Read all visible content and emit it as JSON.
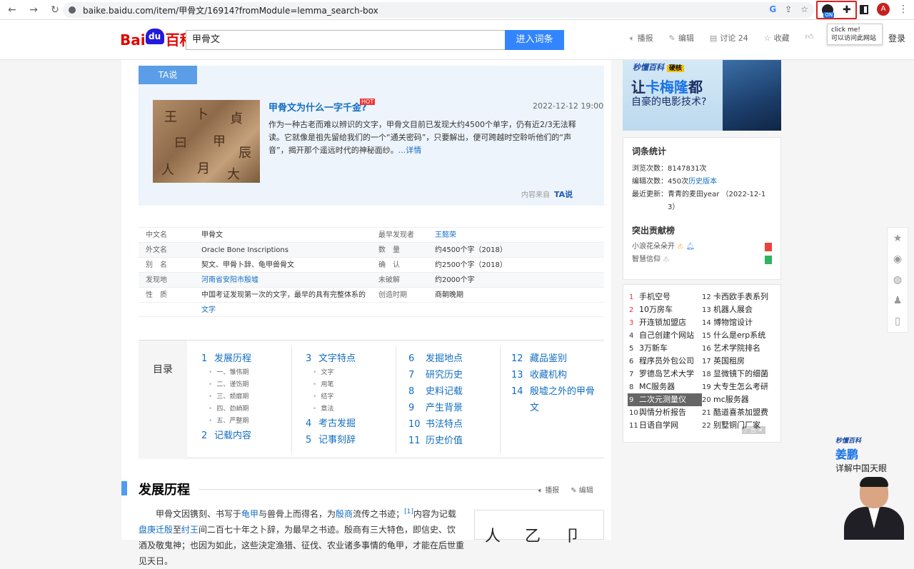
{
  "browser": {
    "url": "baike.baidu.com/item/甲骨文/16914?fromModule=lemma_search-box",
    "avatar_letter": "A",
    "ext_badge": "ON",
    "tooltip_line1": "click me!",
    "tooltip_line2": "可以访问此网站"
  },
  "header": {
    "logo_bai": "Bai",
    "logo_du": "du",
    "logo_baike": "百科",
    "search_value": "甲骨文",
    "search_button": "进入词条",
    "actions": [
      "播报",
      "编辑",
      "讨论 24",
      "收藏",
      "赞"
    ],
    "login": "登录"
  },
  "ta": {
    "tab": "TA说",
    "title": "甲骨文为什么一字千金?",
    "hot_badge": "HOT",
    "date": "2022-12-12 19:00",
    "text": "作为一种古老而难以辨识的文字，甲骨文目前已发现大约4500个单字，仍有近2/3无法释读。它就像是祖先留给我们的一个“通关密码”，只要解出，便可跨越时空聆听他们的“声音”，揭开那个遥远时代的神秘面纱。",
    "more": "...详情",
    "source_label": "内容来自",
    "source_brand": "TA说"
  },
  "infobox": [
    {
      "k1": "中文名",
      "v1": "甲骨文",
      "k2": "最早发现者",
      "v2": "王懿荣"
    },
    {
      "k1": "外文名",
      "v1": "Oracle Bone Inscriptions",
      "k2": "数　量",
      "v2": "约4500个字（2018）"
    },
    {
      "k1": "别　名",
      "v1": "契文、甲骨卜辞、龟甲兽骨文",
      "k2": "确　认",
      "v2": "约2500个字（2018）"
    },
    {
      "k1": "发现地",
      "v1": "河南省安阳市殷墟",
      "k2": "未破解",
      "v2": "约2000个字"
    },
    {
      "k1": "性　质",
      "v1": "中国考证发现第一次的文字，最早的具有完整体系的",
      "k2": "创造时期",
      "v2": "商朝晚期"
    },
    {
      "k1": "",
      "v1": "文字",
      "k2": "",
      "v2": ""
    }
  ],
  "toc": {
    "label": "目录",
    "col1": [
      {
        "num": "1",
        "label": "发展历程"
      },
      {
        "sub": "一、雏伟期"
      },
      {
        "sub": "二、谨饬期"
      },
      {
        "sub": "三、颓靡期"
      },
      {
        "sub": "四、劲峭期"
      },
      {
        "sub": "五、严整期"
      },
      {
        "num": "2",
        "label": "记载内容"
      }
    ],
    "col2": [
      {
        "num": "3",
        "label": "文字特点"
      },
      {
        "sub": "文字"
      },
      {
        "sub": "用笔"
      },
      {
        "sub": "结字"
      },
      {
        "sub": "章法"
      },
      {
        "num": "4",
        "label": "考古发掘"
      },
      {
        "num": "5",
        "label": "记事刻辞"
      }
    ],
    "col3": [
      {
        "num": "6",
        "label": "发掘地点"
      },
      {
        "num": "7",
        "label": "研究历史"
      },
      {
        "num": "8",
        "label": "史料记载"
      },
      {
        "num": "9",
        "label": "产生背景"
      },
      {
        "num": "10",
        "label": "书法特点"
      },
      {
        "num": "11",
        "label": "历史价值"
      }
    ],
    "col4": [
      {
        "num": "12",
        "label": "藏品鉴别"
      },
      {
        "num": "13",
        "label": "收藏机构"
      },
      {
        "num": "14",
        "label": "殷墟之外的甲骨"
      },
      {
        "num": "",
        "label": "文"
      }
    ]
  },
  "section": {
    "title": "发展历程",
    "play": "播报",
    "edit": "编辑",
    "body_a": "甲骨文因镌刻、书写于",
    "link1": "龟甲",
    "body_b": "与兽骨上而得名，为",
    "link2": "殷商",
    "body_c": "流传之书迹；",
    "ref": "[1]",
    "body_d": "内容为记载",
    "link3": "盘庚迁殷",
    "body_e": "至",
    "link4": "纣王",
    "body_f": "间二百七十年之卜辞，为最早之书迹。殷商有三大特色，即信史、饮酒及敬鬼神；也因为如此，这些決定渔猎、征伐、农业诸多事情的龟甲，才能在后世重见天日。"
  },
  "ad": {
    "brand": "秒懂百科",
    "brand_tag": "硬核",
    "line1_pre": "让",
    "line1_em": "卡梅隆",
    "line1_post": "都",
    "line2": "自豪的电影技术?"
  },
  "stats": {
    "title": "词条统计",
    "views_label": "浏览次数：",
    "views": "8147831次",
    "edits_label": "编辑次数：",
    "edits": "450次",
    "history_link": "历史版本",
    "updated_label": "最近更新：",
    "updated_by": "青青的麦田year",
    "updated_date_a": "（2022-12-1",
    "updated_date_b": "3）",
    "contrib_title": "突出贡献榜",
    "contributors": [
      "小浪花朵朵开",
      "智慧信仰"
    ]
  },
  "hotlist": {
    "items": [
      {
        "n": "1",
        "t": "手机空号"
      },
      {
        "n": "2",
        "t": "10万房车"
      },
      {
        "n": "3",
        "t": "开连锁加盟店"
      },
      {
        "n": "4",
        "t": "自己创建个网站"
      },
      {
        "n": "5",
        "t": "3万新车"
      },
      {
        "n": "6",
        "t": "程序员外包公司"
      },
      {
        "n": "7",
        "t": "罗德岛艺术大学"
      },
      {
        "n": "8",
        "t": "MC服务器"
      },
      {
        "n": "9",
        "t": "二次元测量仪"
      },
      {
        "n": "10",
        "t": "舆情分析报告"
      },
      {
        "n": "11",
        "t": "日语自学网"
      },
      {
        "n": "12",
        "t": "卡西欧手表系列"
      },
      {
        "n": "13",
        "t": "机器人展会"
      },
      {
        "n": "14",
        "t": "博物馆设计"
      },
      {
        "n": "15",
        "t": "什么是erp系统"
      },
      {
        "n": "16",
        "t": "艺术学院排名"
      },
      {
        "n": "17",
        "t": "英国租房"
      },
      {
        "n": "18",
        "t": "显微镜下的细菌"
      },
      {
        "n": "19",
        "t": "大专生怎么考研"
      },
      {
        "n": "20",
        "t": "mc服务器"
      },
      {
        "n": "21",
        "t": "酷道喜茶加盟费"
      },
      {
        "n": "22",
        "t": "别墅铜门厂家"
      }
    ],
    "ad_tag": "广告"
  },
  "promo": {
    "brand": "秒懂百科",
    "name": "姜鹏",
    "desc": "详解中国天眼"
  }
}
